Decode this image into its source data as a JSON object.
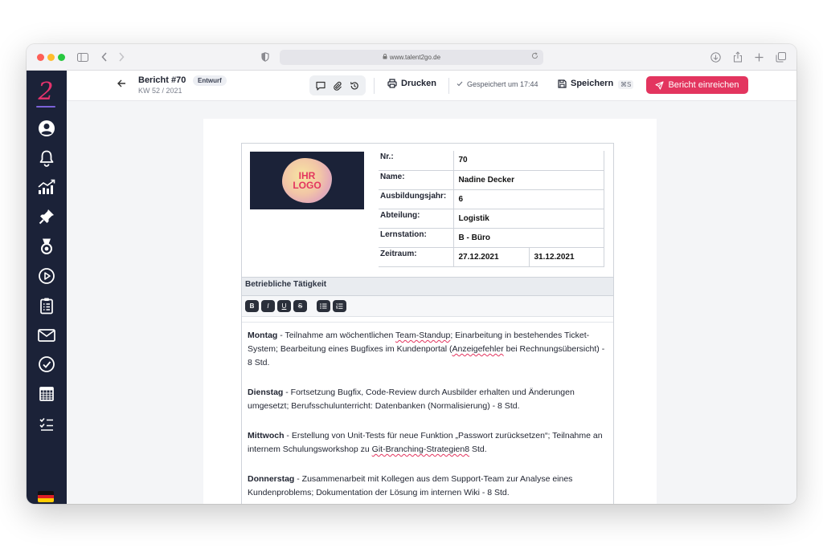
{
  "browser": {
    "url": "www.talent2go.de"
  },
  "sidebar": {
    "logo_text": "2",
    "items": [
      {
        "icon": "user-icon"
      },
      {
        "icon": "bell-icon"
      },
      {
        "icon": "chart-icon"
      },
      {
        "icon": "pin-icon"
      },
      {
        "icon": "medal-icon"
      },
      {
        "icon": "play-circle-icon"
      },
      {
        "icon": "clipboard-icon"
      },
      {
        "icon": "mail-icon"
      },
      {
        "icon": "check-circle-icon"
      },
      {
        "icon": "calendar-icon"
      },
      {
        "icon": "checklist-icon"
      }
    ],
    "language_flag": "de"
  },
  "header": {
    "title": "Bericht #70",
    "subtitle": "KW 52 / 2021",
    "badge": "Entwurf",
    "print_label": "Drucken",
    "saved_status": "Gespeichert um 17:44",
    "save_label": "Speichern",
    "save_shortcut": "⌘S",
    "submit_label": "Bericht einreichen"
  },
  "report": {
    "logo_line1": "IHR",
    "logo_line2": "LOGO",
    "fields": {
      "nr_label": "Nr.:",
      "nr_value": "70",
      "name_label": "Name:",
      "name_value": "Nadine Decker",
      "year_label": "Ausbildungsjahr:",
      "year_value": "6",
      "dept_label": "Abteilung:",
      "dept_value": "Logistik",
      "station_label": "Lernstation:",
      "station_value": "B - Büro",
      "period_label": "Zeitraum:",
      "period_from": "27.12.2021",
      "period_to": "31.12.2021"
    },
    "section_title": "Betriebliche Tätigkeit",
    "toolbar": {
      "bold": "B",
      "italic": "I",
      "underline": "U",
      "strike": "S"
    },
    "entries": {
      "mon_day": "Montag",
      "mon_a": " - Teilnahme am wöchentlichen ",
      "mon_sp1": "Team-Standup",
      "mon_b": "; Einarbeitung in bestehendes Ticket-System; Bearbeitung eines Bugfixes im Kundenportal (",
      "mon_sp2": "Anzeigefehler",
      "mon_c": " bei Rechnungsübersicht) - 8 Std.",
      "tue_day": "Dienstag",
      "tue_text": " - Fortsetzung Bugfix, Code-Review durch Ausbilder erhalten und Änderungen umgesetzt; Berufsschulunterricht: Datenbanken (Normalisierung) - 8 Std.",
      "wed_day": "Mittwoch",
      "wed_a": " - Erstellung von Unit-Tests für neue Funktion „Passwort zurücksetzen“; Teilnahme an internem Schulungsworkshop zu ",
      "wed_sp": "Git-Branching-Strategien8",
      "wed_b": " Std.",
      "thu_day": "Donnerstag",
      "thu_text": " - Zusammenarbeit mit Kollegen aus dem Support-Team zur Analyse eines Kundenproblems; Dokumentation der Lösung im internen Wiki - 8 Std."
    }
  }
}
